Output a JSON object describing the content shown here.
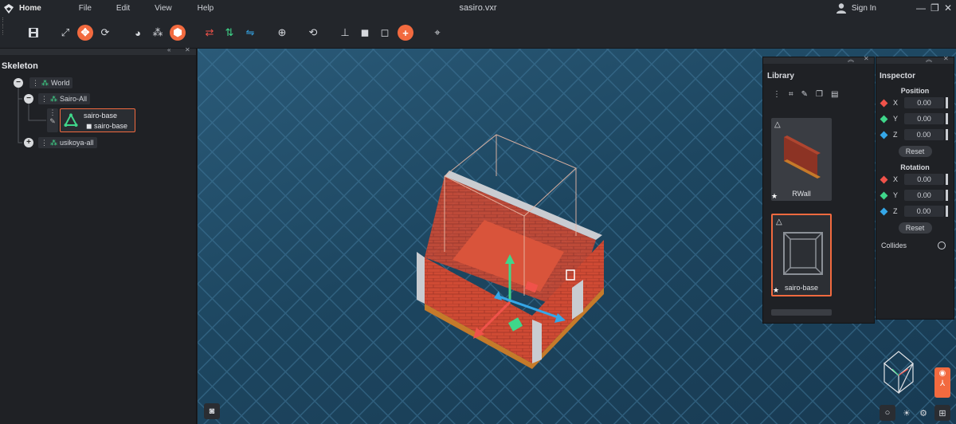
{
  "menubar": {
    "home_label": "Home",
    "items": [
      "File",
      "Edit",
      "View",
      "Help"
    ],
    "title": "sasiro.vxr",
    "signin_label": "Sign In"
  },
  "skeleton": {
    "title": "Skeleton",
    "nodes": [
      "World",
      "Sairo-All",
      "sairo-base",
      "sairo-base",
      "usikoya-all"
    ]
  },
  "library": {
    "title": "Library",
    "cards": [
      "RWall",
      "sairo-base"
    ]
  },
  "inspector": {
    "title": "Inspector",
    "position_label": "Position",
    "rotation_label": "Rotation",
    "axes": [
      "X",
      "Y",
      "Z"
    ],
    "position_values": [
      "0.00",
      "0.00",
      "0.00"
    ],
    "rotation_values": [
      "0.00",
      "0.00",
      "0.00"
    ],
    "reset_label": "Reset",
    "collides_label": "Collides"
  },
  "colors": {
    "accent": "#f26a3f",
    "axis_x": "#f0524a",
    "axis_y": "#3fd68a",
    "axis_z": "#35a7e8"
  }
}
